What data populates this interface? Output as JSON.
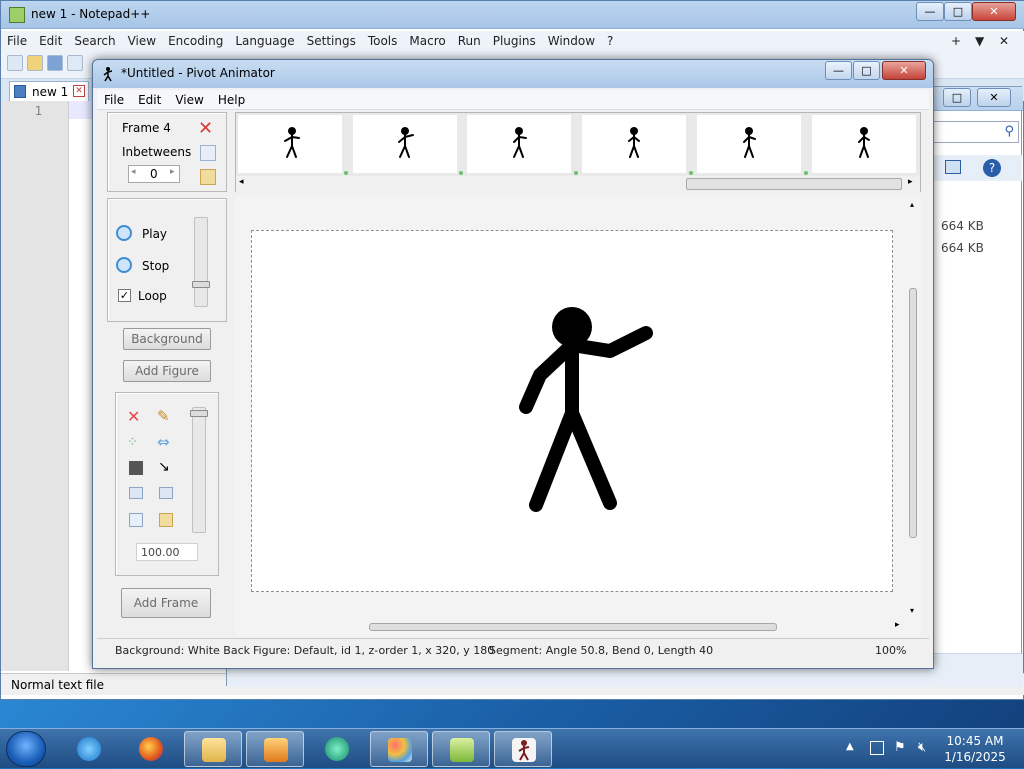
{
  "notepad": {
    "title": "new 1 - Notepad++",
    "menu": [
      "File",
      "Edit",
      "Search",
      "View",
      "Encoding",
      "Language",
      "Settings",
      "Tools",
      "Macro",
      "Run",
      "Plugins",
      "Window",
      "?"
    ],
    "tab_label": "new 1",
    "line_number": "1",
    "status": "Normal text file",
    "controls": {
      "minimize": "—",
      "maximize": "□",
      "close": "✕"
    },
    "menu_right": {
      "plus": "+",
      "down": "▼",
      "close": "✕"
    }
  },
  "explorer": {
    "sizes": [
      "664 KB",
      "664 KB"
    ],
    "controls": {
      "maximize": "□",
      "close": "✕"
    }
  },
  "pivot": {
    "title": "*Untitled - Pivot Animator",
    "menu": [
      "File",
      "Edit",
      "View",
      "Help"
    ],
    "controls": {
      "minimize": "—",
      "maximize": "□",
      "close": "✕"
    },
    "frame_label": "Frame 4",
    "inbetweens_label": "Inbetweens",
    "inbetweens_value": "0",
    "play_label": "Play",
    "stop_label": "Stop",
    "loop_label": "Loop",
    "loop_checked": true,
    "background_button": "Background",
    "add_figure_button": "Add Figure",
    "scale_value": "100.00",
    "add_frame_button": "Add Frame",
    "status": {
      "background": "Background: White Back",
      "figure": "Figure: Default,  id 1,  z-order 1,  x 320, y 180",
      "segment": "Segment: Angle 50.8,  Bend 0,  Length 40",
      "zoom": "100%"
    },
    "tool_icons": [
      "delete-icon",
      "edit-pencil-icon",
      "join-icon",
      "flip-icon",
      "color-fill-icon",
      "scale-tool-icon",
      "bring-front-icon",
      "send-back-icon",
      "copy-icon",
      "paste-icon"
    ]
  },
  "taskbar": {
    "apps": [
      "internet-explorer",
      "firefox",
      "file-explorer",
      "media-player",
      "joy-app",
      "paint",
      "notepad-plus-plus",
      "pivot-animator"
    ],
    "time": "10:45 AM",
    "date": "1/16/2025"
  },
  "colors": {
    "desktop": "#1f6fb8",
    "window_title": "#a9c7e8",
    "stickman": "#000000",
    "frame_dot": "#6bc36b"
  }
}
